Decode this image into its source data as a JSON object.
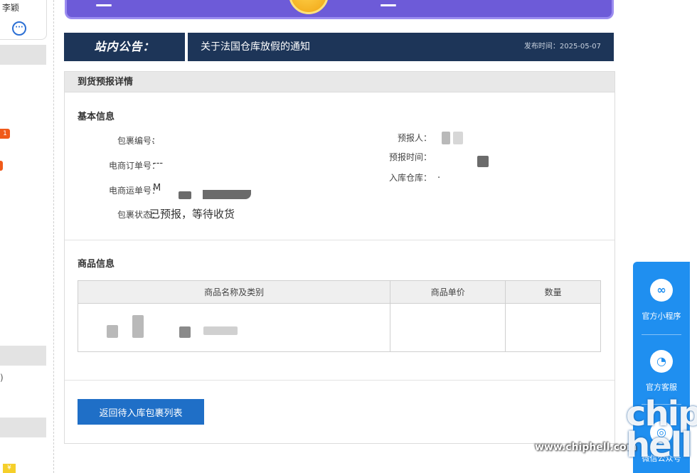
{
  "sidebar": {
    "user_name": "李颖",
    "badge_1": "1",
    "paren": ")",
    "badge_y": "¥"
  },
  "notice": {
    "label": "站内公告：",
    "title": "关于法国仓库放假的通知",
    "date": "发布时间：2025-05-07"
  },
  "panel": {
    "header": "到货预报详情",
    "basic_info": {
      "title": "基本信息",
      "package_no_label": "包裹编号：",
      "order_no_label": "电商订单号：",
      "order_no_value": "---",
      "shipping_no_label": "电商运单号：",
      "shipping_no_value": "M",
      "status_label": "包裹状态：",
      "status_value": "已预报，等待收货",
      "forecaster_label": "预报人：",
      "forecast_time_label": "预报时间：",
      "warehouse_label": "入库仓库："
    },
    "goods_info": {
      "title": "商品信息",
      "columns": [
        "商品名称及类别",
        "商品单价",
        "数量"
      ]
    },
    "back_button": "返回待入库包裹列表"
  },
  "float_bar": {
    "items": [
      {
        "label": "官方小程序",
        "icon": "mini-program-icon"
      },
      {
        "label": "官方客服",
        "icon": "customer-service-icon"
      },
      {
        "label": "微信公众号",
        "icon": "wechat-official-icon"
      }
    ]
  },
  "watermark": {
    "url": "www.chiphell.com",
    "logo": "chip hell"
  },
  "colors": {
    "notice_bg": "#1d3558",
    "primary_button": "#1f6fc7",
    "float_bar": "#1f8ff0",
    "banner": "#6d5bd8"
  }
}
